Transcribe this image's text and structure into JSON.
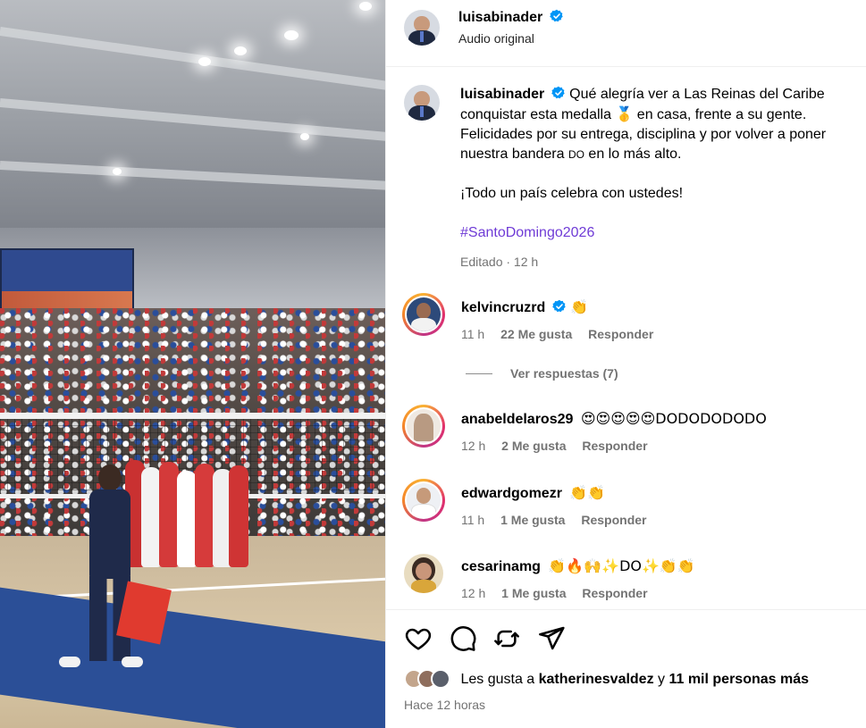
{
  "post": {
    "author": "luisabinader",
    "audio": "Audio original",
    "caption": {
      "line1_prefix": "Qué alegría ver a Las Reinas del Caribe conquistar esta medalla ",
      "medal_emoji": "🥇",
      "line1_suffix": " en casa, frente a su gente. Felicidades por su entrega, disciplina y por volver a poner nuestra bandera ",
      "flag_text": "DO",
      "line1_end": " en lo más alto.",
      "line2": "¡Todo un país celebra con ustedes!",
      "hashtag": "#SantoDomingo2026"
    },
    "edited": "Editado · 12 h"
  },
  "comments": [
    {
      "username": "kelvincruzrd",
      "verified": true,
      "text": "👏",
      "time": "11 h",
      "likes": "22 Me gusta",
      "reply": "Responder",
      "avatar_color": "#2d4a7a"
    },
    {
      "username": "anabeldelaros29",
      "verified": false,
      "text": "😍😍😍😍😍DODODODODO",
      "time": "12 h",
      "likes": "2 Me gusta",
      "reply": "Responder",
      "avatar_color": "#b8a894"
    },
    {
      "username": "edwardgomezr",
      "verified": false,
      "text": "👏👏",
      "time": "11 h",
      "likes": "1 Me gusta",
      "reply": "Responder",
      "avatar_color": "#e7e9ee"
    },
    {
      "username": "cesarinamg",
      "verified": false,
      "text": "👏🔥🙌✨DO✨👏👏",
      "time": "12 h",
      "likes": "1 Me gusta",
      "reply": "Responder",
      "avatar_color": "#c8b58a"
    }
  ],
  "view_replies": "Ver respuestas (7)",
  "likes_summary": {
    "prefix": "Les gusta a ",
    "user": "katherinesvaldez",
    "middle": " y ",
    "others": "11 mil personas más"
  },
  "time_ago": "Hace 12 horas",
  "icons": {
    "like": "heart-icon",
    "comment": "comment-icon",
    "repost": "repost-icon",
    "share": "send-icon",
    "verified": "verified-badge-icon"
  },
  "colors": {
    "verified": "#0095f6",
    "hashtag": "#6f3bd6",
    "muted": "#737373"
  }
}
